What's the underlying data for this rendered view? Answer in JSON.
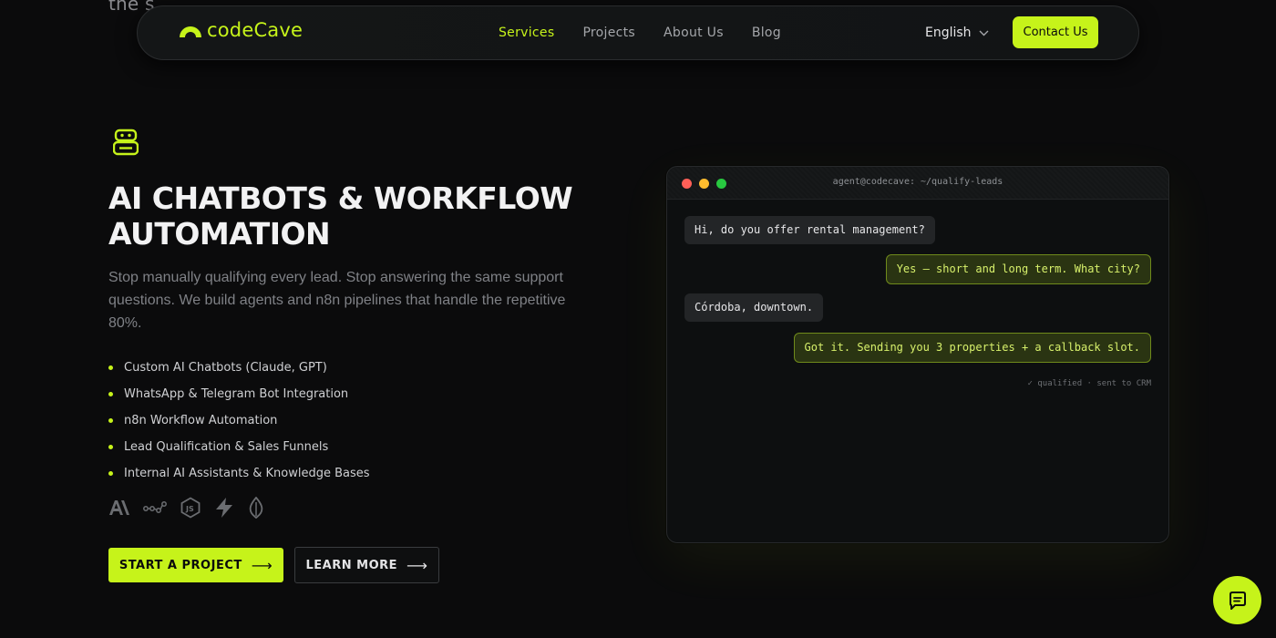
{
  "background_text": "the s",
  "nav": {
    "brand": "codeCave",
    "links": [
      "Services",
      "Projects",
      "About Us",
      "Blog"
    ],
    "active_link": "Services",
    "language": "English",
    "contact_label": "Contact Us"
  },
  "hero": {
    "icon": "robot-icon",
    "title": "AI CHATBOTS & WORKFLOW AUTOMATION",
    "description": "Stop manually qualifying every lead. Stop answering the same support questions. We build agents and n8n pipelines that handle the repetitive 80%.",
    "features": [
      "Custom AI Chatbots (Claude, GPT)",
      "WhatsApp & Telegram Bot Integration",
      "n8n Workflow Automation",
      "Lead Qualification & Sales Funnels",
      "Internal AI Assistants & Knowledge Bases"
    ],
    "tech_icons": [
      "anthropic-icon",
      "n8n-icon",
      "nodejs-icon",
      "zap-icon",
      "mongodb-icon"
    ],
    "primary_cta": "START A PROJECT",
    "secondary_cta": "LEARN MORE"
  },
  "terminal": {
    "title": "agent@codecave: ~/qualify-leads",
    "messages": [
      {
        "from": "user",
        "text": "Hi, do you offer rental management?"
      },
      {
        "from": "bot",
        "text": "Yes — short and long term. What city?"
      },
      {
        "from": "user",
        "text": "Córdoba, downtown."
      },
      {
        "from": "bot",
        "text": "Got it. Sending you 3 properties + a callback slot."
      }
    ],
    "status": "✓ qualified · sent to CRM"
  },
  "colors": {
    "accent": "#c6f31a",
    "background": "#0b0b0c"
  }
}
